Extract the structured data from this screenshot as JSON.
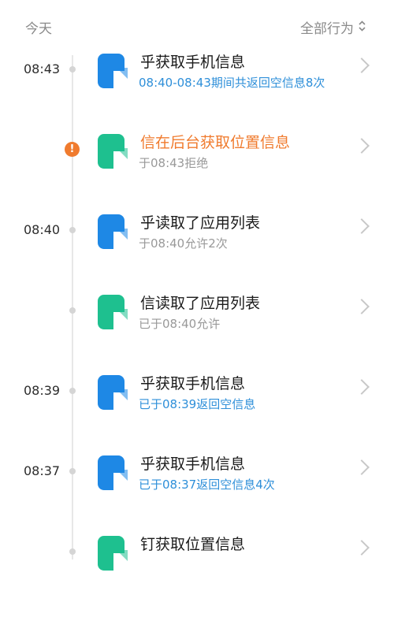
{
  "header": {
    "today": "今天",
    "filter_label": "全部行为",
    "filter_icon": "up-down-chevron-icon"
  },
  "rows": [
    {
      "time": "08:43",
      "title": "乎获取手机信息",
      "sub": "08:40-08:43期间共返回空信息8次",
      "sub_color": "blue",
      "marker": "dot",
      "icon_color": "#1e88e5"
    },
    {
      "time": "",
      "title": "信在后台获取位置信息",
      "sub": "于08:43拒绝",
      "sub_color": "gray",
      "marker": "warning",
      "warning_symbol": "!",
      "icon_color": "#1ec08f",
      "title_color": "#f07b2e"
    },
    {
      "time": "08:40",
      "title": "乎读取了应用列表",
      "sub": "于08:40允许2次",
      "sub_color": "gray",
      "marker": "dot",
      "icon_color": "#1e88e5"
    },
    {
      "time": "",
      "title": "信读取了应用列表",
      "sub": "已于08:40允许",
      "sub_color": "gray",
      "marker": "dot",
      "icon_color": "#1ec08f"
    },
    {
      "time": "08:39",
      "title": "乎获取手机信息",
      "sub": "已于08:39返回空信息",
      "sub_color": "blue",
      "marker": "dot",
      "icon_color": "#1e88e5"
    },
    {
      "time": "08:37",
      "title": "乎获取手机信息",
      "sub": "已于08:37返回空信息4次",
      "sub_color": "blue",
      "marker": "dot",
      "icon_color": "#1e88e5"
    },
    {
      "time": "",
      "title": "钉获取位置信息",
      "sub": "",
      "sub_color": "gray",
      "marker": "dot",
      "icon_color": "#1ec08f"
    }
  ]
}
